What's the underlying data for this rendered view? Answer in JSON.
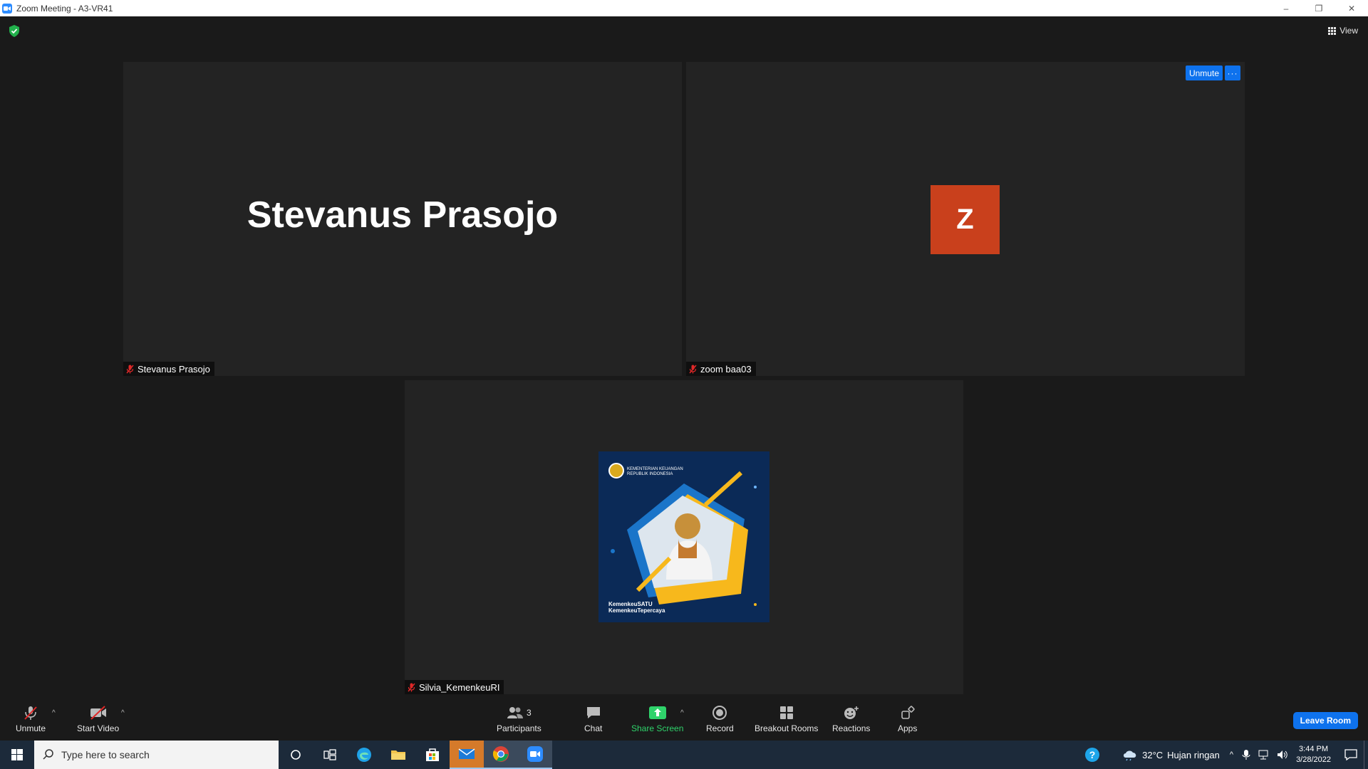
{
  "window": {
    "title": "Zoom Meeting - A3-VR41",
    "controls": [
      "–",
      "❐",
      "✕"
    ]
  },
  "header": {
    "view_label": "View"
  },
  "tiles": [
    {
      "display_name": "Stevanus Prasojo",
      "label": "Stevanus Prasojo",
      "muted": true
    },
    {
      "avatar_letter": "Z",
      "avatar_color": "#c9401c",
      "label": "zoom baa03",
      "muted": true,
      "unmute_label": "Unmute",
      "more_label": "···"
    },
    {
      "label": "Silvia_KemenkeuRI",
      "muted": true,
      "poster": {
        "org": [
          "KEMENTERIAN KEUANGAN",
          "REPUBLIK INDONESIA"
        ],
        "tagline": [
          "KemenkeuSATU",
          "KemenkeuTepercaya"
        ]
      }
    }
  ],
  "toolbar": {
    "unmute": "Unmute",
    "start_video": "Start Video",
    "participants": "Participants",
    "participants_count": "3",
    "chat": "Chat",
    "share_screen": "Share Screen",
    "record": "Record",
    "breakout_rooms": "Breakout Rooms",
    "reactions": "Reactions",
    "apps": "Apps",
    "leave": "Leave Room",
    "share_color": "#2fd36b",
    "accent_color": "#0e72ed"
  },
  "taskbar": {
    "search_placeholder": "Type here to search",
    "weather": "32°C",
    "weather_desc": "Hujan ringan",
    "time": "3:44 PM",
    "date": "3/28/2022"
  }
}
